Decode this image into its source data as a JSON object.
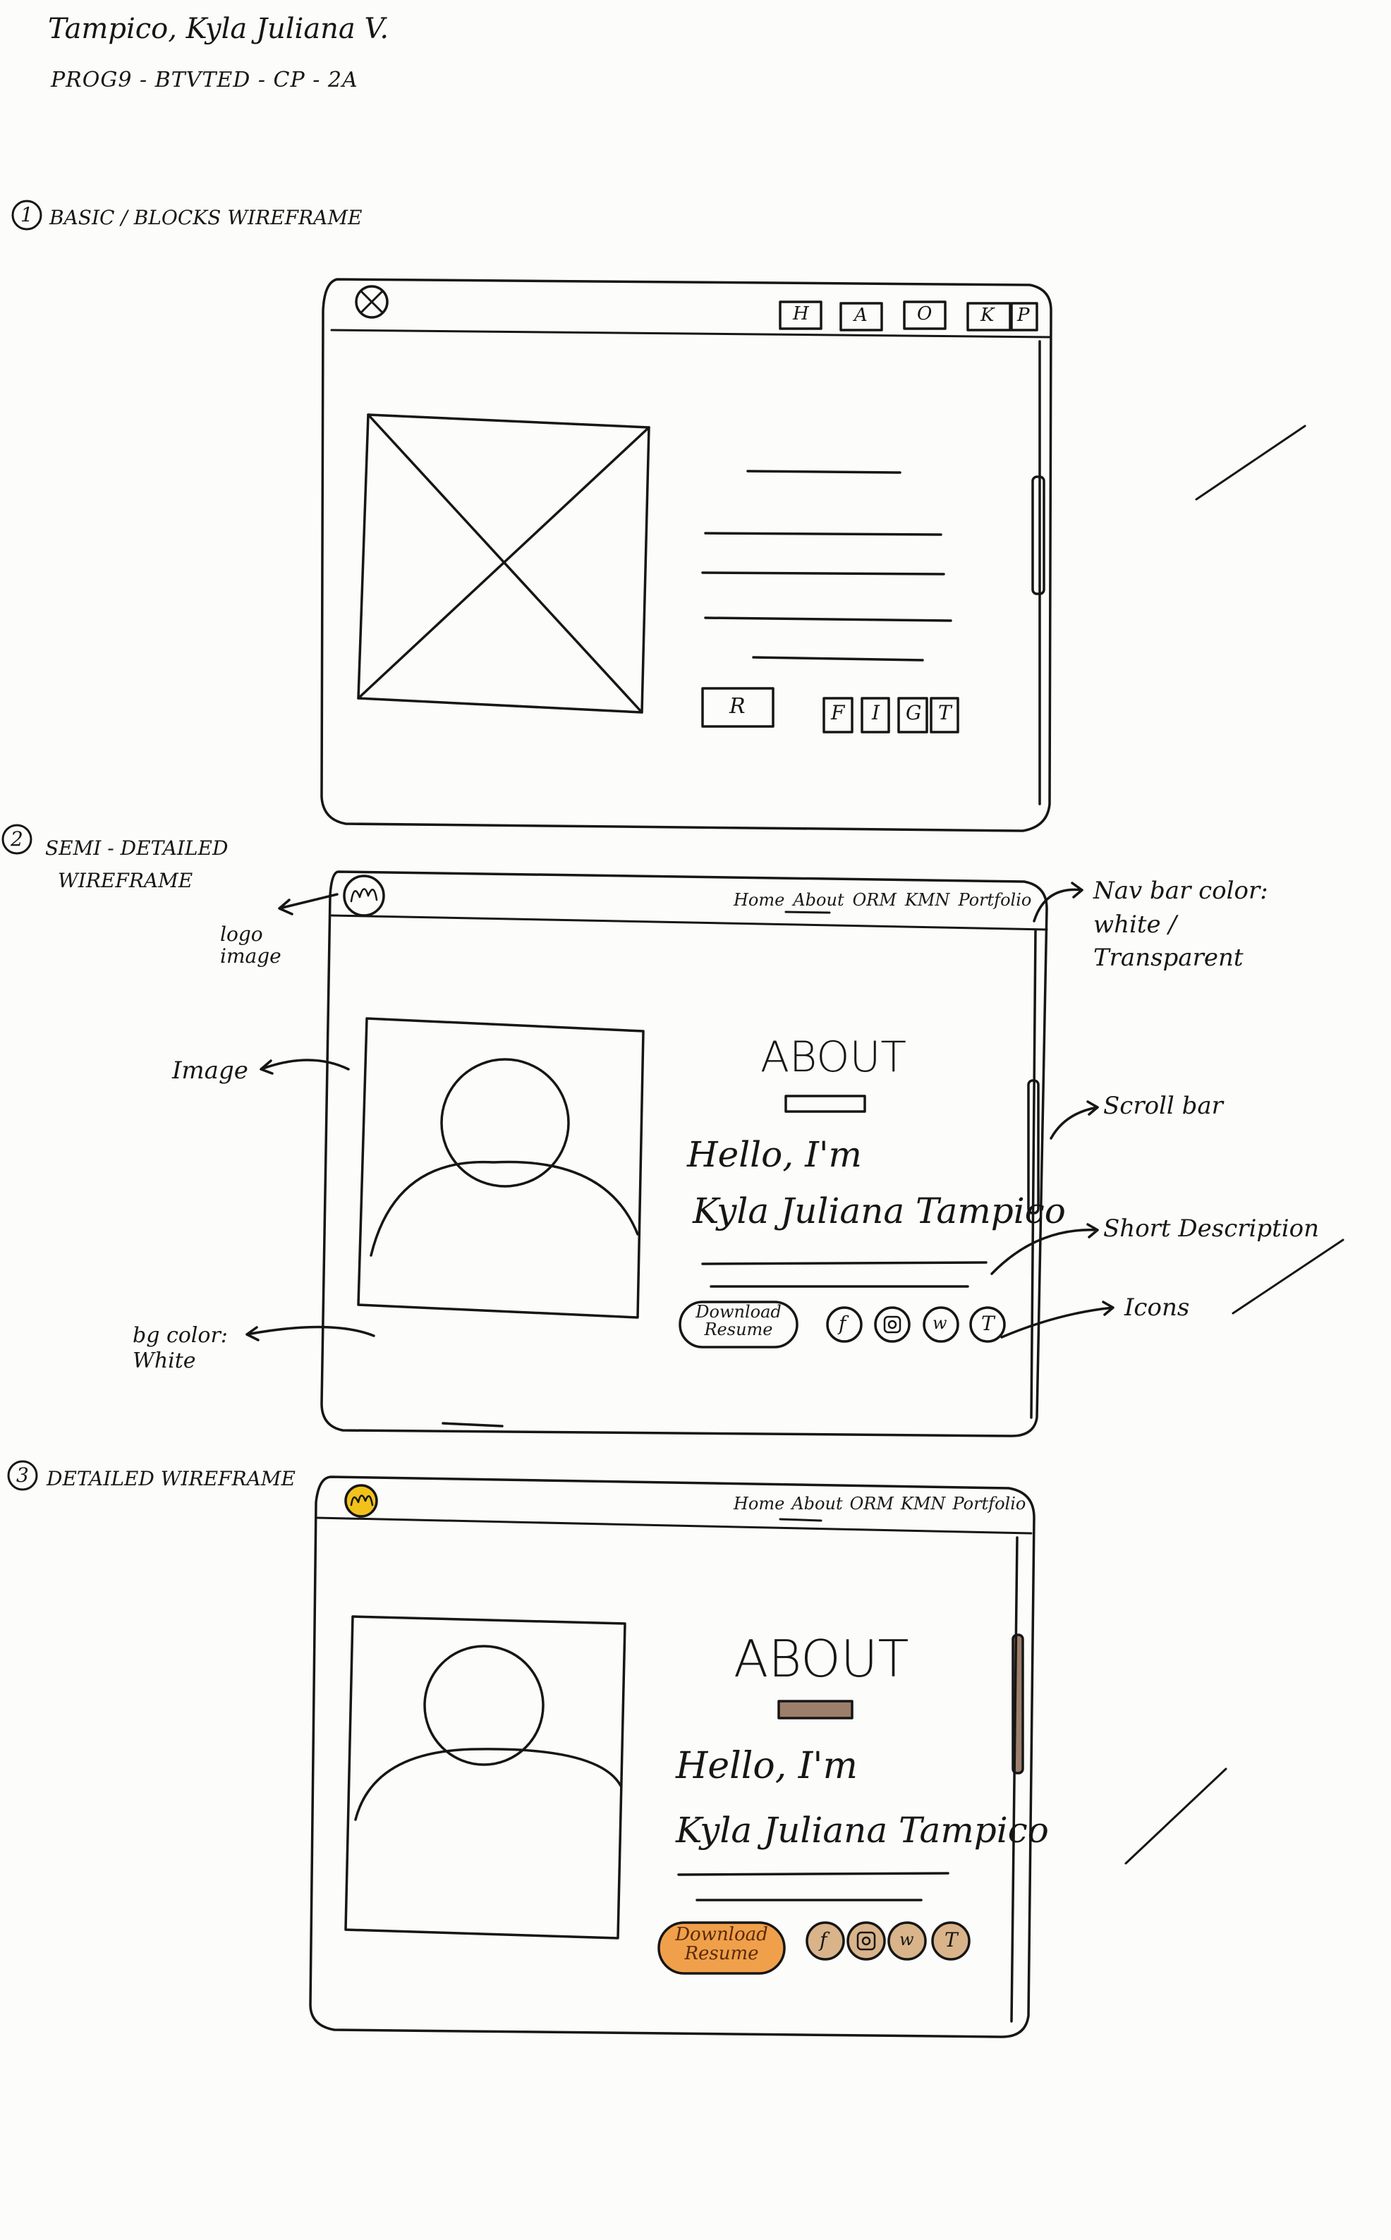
{
  "header": {
    "name": "Tampico, Kyla Juliana V.",
    "section": "PROG9 - BTVTED - CP - 2A"
  },
  "sections": [
    {
      "number": "1",
      "title": "BASIC / BLOCKS WIREFRAME"
    },
    {
      "number": "2",
      "title": "SEMI - DETAILED",
      "title_line2": "WIREFRAME"
    },
    {
      "number": "3",
      "title": "DETAILED WIREFRAME"
    }
  ],
  "wireframe1": {
    "nav_boxes": [
      "H",
      "A",
      "O",
      "K",
      "P"
    ],
    "resume_box": "R",
    "social_boxes": [
      "F",
      "I",
      "G",
      "T"
    ]
  },
  "wireframe2": {
    "nav_links": [
      "Home",
      "About",
      "ORM",
      "KMN",
      "Portfolio"
    ],
    "about_title": "ABOUT",
    "greeting": "Hello, I'm",
    "name": "Kyla Juliana Tampico",
    "download_label_line1": "Download",
    "download_label_line2": "Resume",
    "social_icons": [
      "f",
      "ig",
      "w",
      "T"
    ],
    "annotations": {
      "logo": "logo image",
      "image": "Image",
      "bg_color": "bg color: White",
      "navbar_color": "Nav bar color: white / Transparent",
      "scroll_bar": "Scroll bar",
      "short_description": "Short Description",
      "icons": "Icons"
    }
  },
  "wireframe3": {
    "nav_links": [
      "Home",
      "About",
      "ORM",
      "KMN",
      "Portfolio"
    ],
    "about_title": "ABOUT",
    "greeting": "Hello, I'm",
    "name": "Kyla Juliana Tampico",
    "download_label_line1": "Download",
    "download_label_line2": "Resume",
    "social_icons": [
      "f",
      "ig",
      "w",
      "T"
    ]
  },
  "colors": {
    "ink": "#161616",
    "accent_orange": "#f0a04a",
    "accent_brown": "#9c7f6b",
    "logo_yellow": "#f2c21b",
    "paper": "#fcfcfb"
  }
}
